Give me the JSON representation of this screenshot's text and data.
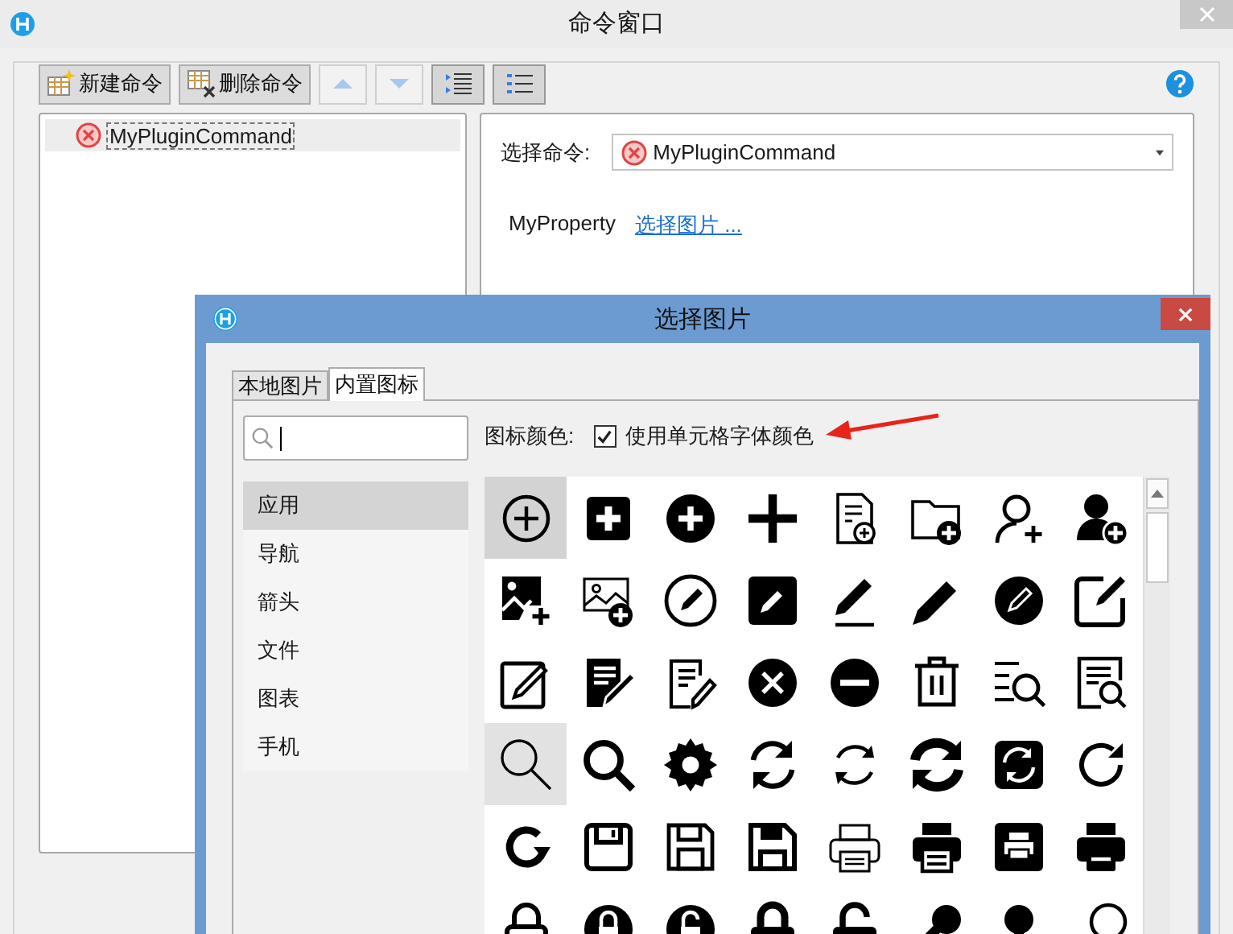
{
  "window": {
    "title": "命令窗口"
  },
  "toolbar": [
    {
      "kind": "new",
      "label": "新建命令",
      "disabled": false
    },
    {
      "kind": "delete",
      "label": "删除命令",
      "disabled": false
    },
    {
      "kind": "up",
      "disabled": true
    },
    {
      "kind": "down",
      "disabled": true
    },
    {
      "kind": "indent",
      "disabled": false
    },
    {
      "kind": "outdent",
      "disabled": false
    }
  ],
  "command_tree": [
    {
      "label": "MyPluginCommand",
      "selected": true
    }
  ],
  "command_editor": {
    "select_label": "选择命令:",
    "select_value": "MyPluginCommand",
    "property_name": "MyProperty",
    "property_link": "选择图片 ..."
  },
  "dialog": {
    "title": "选择图片",
    "tabs": [
      {
        "label": "本地图片",
        "selected": false
      },
      {
        "label": "内置图标",
        "selected": true
      }
    ],
    "categories": [
      {
        "label": "应用",
        "selected": true
      },
      {
        "label": "导航",
        "selected": false
      },
      {
        "label": "箭头",
        "selected": false
      },
      {
        "label": "文件",
        "selected": false
      },
      {
        "label": "图表",
        "selected": false
      },
      {
        "label": "手机",
        "selected": false
      }
    ],
    "color_label": "图标颜色:",
    "use_cell_color": {
      "label": "使用单元格字体颜色",
      "checked": true
    },
    "icons": [
      {
        "selected": true,
        "hovered": false
      },
      {
        "selected": false,
        "hovered": false
      },
      {
        "selected": false,
        "hovered": false
      },
      {
        "selected": false,
        "hovered": false
      },
      {
        "selected": false,
        "hovered": false
      },
      {
        "selected": false,
        "hovered": false
      },
      {
        "selected": false,
        "hovered": false
      },
      {
        "selected": false,
        "hovered": false
      },
      {
        "selected": false,
        "hovered": false
      },
      {
        "selected": false,
        "hovered": false
      },
      {
        "selected": false,
        "hovered": false
      },
      {
        "selected": false,
        "hovered": false
      },
      {
        "selected": false,
        "hovered": false
      },
      {
        "selected": false,
        "hovered": false
      },
      {
        "selected": false,
        "hovered": false
      },
      {
        "selected": false,
        "hovered": false
      },
      {
        "selected": false,
        "hovered": false
      },
      {
        "selected": false,
        "hovered": false
      },
      {
        "selected": false,
        "hovered": false
      },
      {
        "selected": false,
        "hovered": false
      },
      {
        "selected": false,
        "hovered": false
      },
      {
        "selected": false,
        "hovered": false
      },
      {
        "selected": false,
        "hovered": false
      },
      {
        "selected": false,
        "hovered": false
      },
      {
        "selected": false,
        "hovered": true
      },
      {
        "selected": false,
        "hovered": false
      },
      {
        "selected": false,
        "hovered": false
      },
      {
        "selected": false,
        "hovered": false
      },
      {
        "selected": false,
        "hovered": false
      },
      {
        "selected": false,
        "hovered": false
      },
      {
        "selected": false,
        "hovered": false
      },
      {
        "selected": false,
        "hovered": false
      },
      {
        "selected": false,
        "hovered": false
      },
      {
        "selected": false,
        "hovered": false
      },
      {
        "selected": false,
        "hovered": false
      },
      {
        "selected": false,
        "hovered": false
      },
      {
        "selected": false,
        "hovered": false
      },
      {
        "selected": false,
        "hovered": false
      },
      {
        "selected": false,
        "hovered": false
      },
      {
        "selected": false,
        "hovered": false
      },
      {
        "selected": false,
        "hovered": false
      },
      {
        "selected": false,
        "hovered": false
      },
      {
        "selected": false,
        "hovered": false
      },
      {
        "selected": false,
        "hovered": false
      },
      {
        "selected": false,
        "hovered": false
      },
      {
        "selected": false,
        "hovered": false
      },
      {
        "selected": false,
        "hovered": false
      },
      {
        "selected": false,
        "hovered": false
      }
    ]
  }
}
